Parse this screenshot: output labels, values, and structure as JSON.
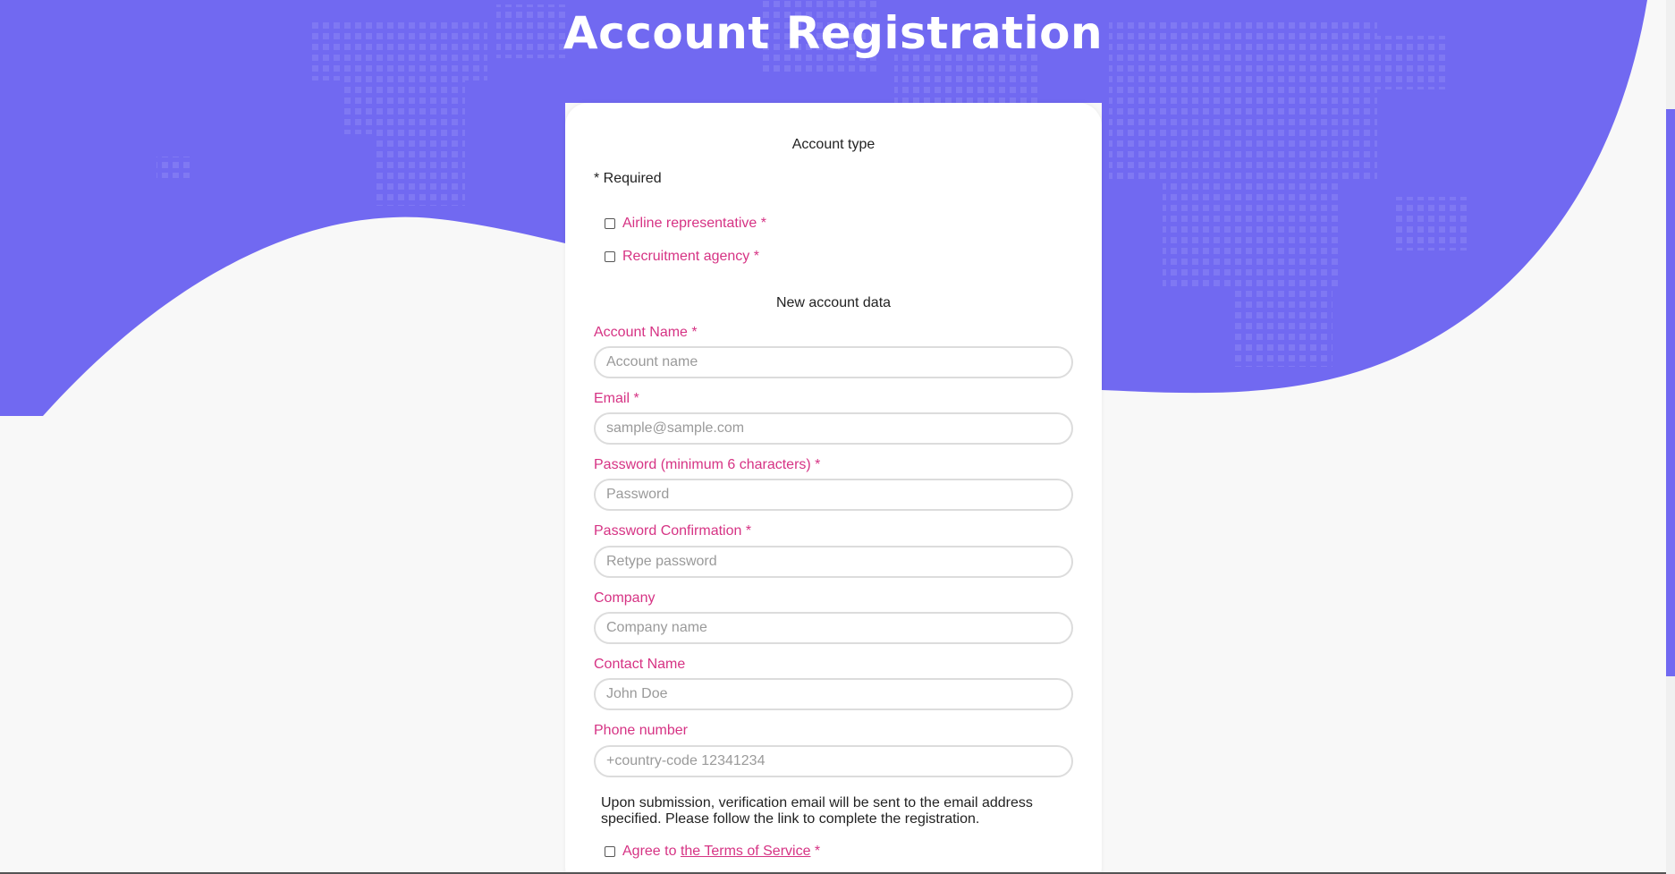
{
  "page": {
    "title": "Account Registration"
  },
  "colors": {
    "accent": "#7169f1",
    "label": "#d63384",
    "background": "#f8f8f8"
  },
  "account_type": {
    "heading": "Account type",
    "required_note": "* Required",
    "options": [
      {
        "label": "Airline representative *"
      },
      {
        "label": "Recruitment agency *"
      }
    ]
  },
  "account_data": {
    "heading": "New account data",
    "fields": [
      {
        "label": "Account Name *",
        "placeholder": "Account name"
      },
      {
        "label": "Email *",
        "placeholder": "sample@sample.com"
      },
      {
        "label": "Password (minimum 6 characters) *",
        "placeholder": "Password"
      },
      {
        "label": "Password Confirmation *",
        "placeholder": "Retype password"
      },
      {
        "label": "Company",
        "placeholder": "Company name"
      },
      {
        "label": "Contact Name",
        "placeholder": "John Doe"
      },
      {
        "label": "Phone number",
        "placeholder": "+country-code 12341234"
      }
    ]
  },
  "notice": "Upon submission, verification email will be sent to the email address specified. Please follow the link to complete the registration.",
  "terms": {
    "prefix": "Agree to ",
    "link": "the Terms of Service",
    "suffix": " *"
  }
}
